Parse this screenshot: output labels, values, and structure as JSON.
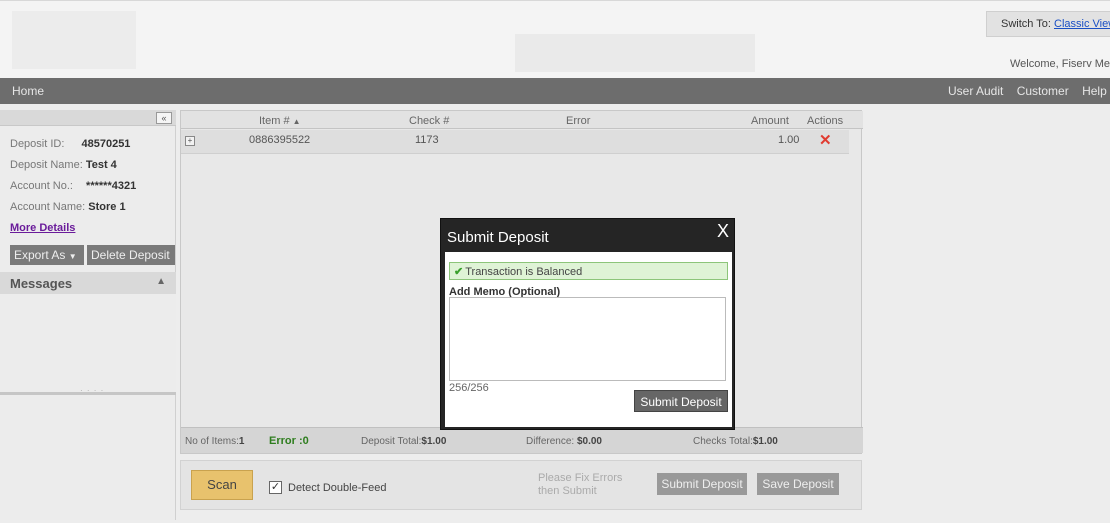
{
  "header": {
    "switch_to": "Switch To:",
    "classic_view": "Classic View",
    "welcome": "Welcome, Fiserv Merchant"
  },
  "nav": {
    "home": "Home",
    "user_audit": "User Audit",
    "customer": "Customer",
    "help": "Help"
  },
  "deposit": {
    "id_label": "Deposit ID:",
    "id_value": "48570251",
    "name_label": "Deposit Name:",
    "name_value": "Test 4",
    "account_no_label": "Account No.:",
    "account_no_value": "******4321",
    "account_name_label": "Account Name:",
    "account_name_value": "Store 1",
    "more_details": "More Details",
    "export_as": "Export As",
    "delete_deposit": "Delete Deposit",
    "messages": "Messages"
  },
  "grid": {
    "columns": {
      "item": "Item #",
      "check": "Check #",
      "error": "Error",
      "amount": "Amount",
      "actions": "Actions"
    },
    "rows": [
      {
        "item": "0886395522",
        "check": "1173",
        "error": "",
        "amount": "1.00"
      }
    ],
    "footer": {
      "items_label": "No of Items:",
      "items_value": "1",
      "error": "Error :0",
      "deposit_total_label": "Deposit Total:",
      "deposit_total_value": "$1.00",
      "difference_label": "Difference:",
      "difference_value": "$0.00",
      "checks_total_label": "Checks Total:",
      "checks_total_value": "$1.00"
    }
  },
  "actions": {
    "scan": "Scan",
    "detect_double_feed": "Detect Double-Feed",
    "detect_checked": true,
    "fix_errors": "Please Fix Errors then Submit",
    "submit_deposit": "Submit Deposit",
    "save_deposit": "Save Deposit"
  },
  "modal": {
    "title": "Submit Deposit",
    "close": "X",
    "balanced": "Transaction is Balanced",
    "memo_label": "Add Memo (Optional)",
    "memo_value": "",
    "char_count": "256/256",
    "submit": "Submit Deposit"
  },
  "icons": {
    "collapse": "double-chevron-left-icon",
    "sort": "sort-asc-icon",
    "expand": "plus-box-icon",
    "delete": "red-x-icon",
    "check": "green-check-icon",
    "export_dropdown": "caret-down-icon",
    "messages_toggle": "triangle-up-icon"
  }
}
